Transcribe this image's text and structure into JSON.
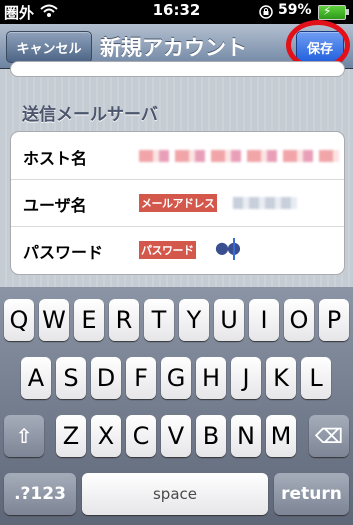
{
  "status_bar": {
    "carrier": "圏外",
    "time": "16:32",
    "battery": "59%"
  },
  "nav": {
    "cancel": "キャンセル",
    "title": "新規アカウント",
    "save": "保存"
  },
  "section_header": "送信メールサーバ",
  "rows": [
    {
      "label": "ホスト名"
    },
    {
      "label": "ユーザ名",
      "annotation": "メールアドレス"
    },
    {
      "label": "パスワード",
      "annotation": "パスワード",
      "masked_value": "●●"
    }
  ],
  "keyboard": {
    "row1": [
      "Q",
      "W",
      "E",
      "R",
      "T",
      "Y",
      "U",
      "I",
      "O",
      "P"
    ],
    "row2": [
      "A",
      "S",
      "D",
      "F",
      "G",
      "H",
      "J",
      "K",
      "L"
    ],
    "row3": [
      "Z",
      "X",
      "C",
      "V",
      "B",
      "N",
      "M"
    ],
    "numbers_key": ".?123",
    "space_key": "space",
    "return_key": "return",
    "shift_symbol": "⇧",
    "delete_symbol": "⌫"
  },
  "annotation_color": "#e3101a"
}
